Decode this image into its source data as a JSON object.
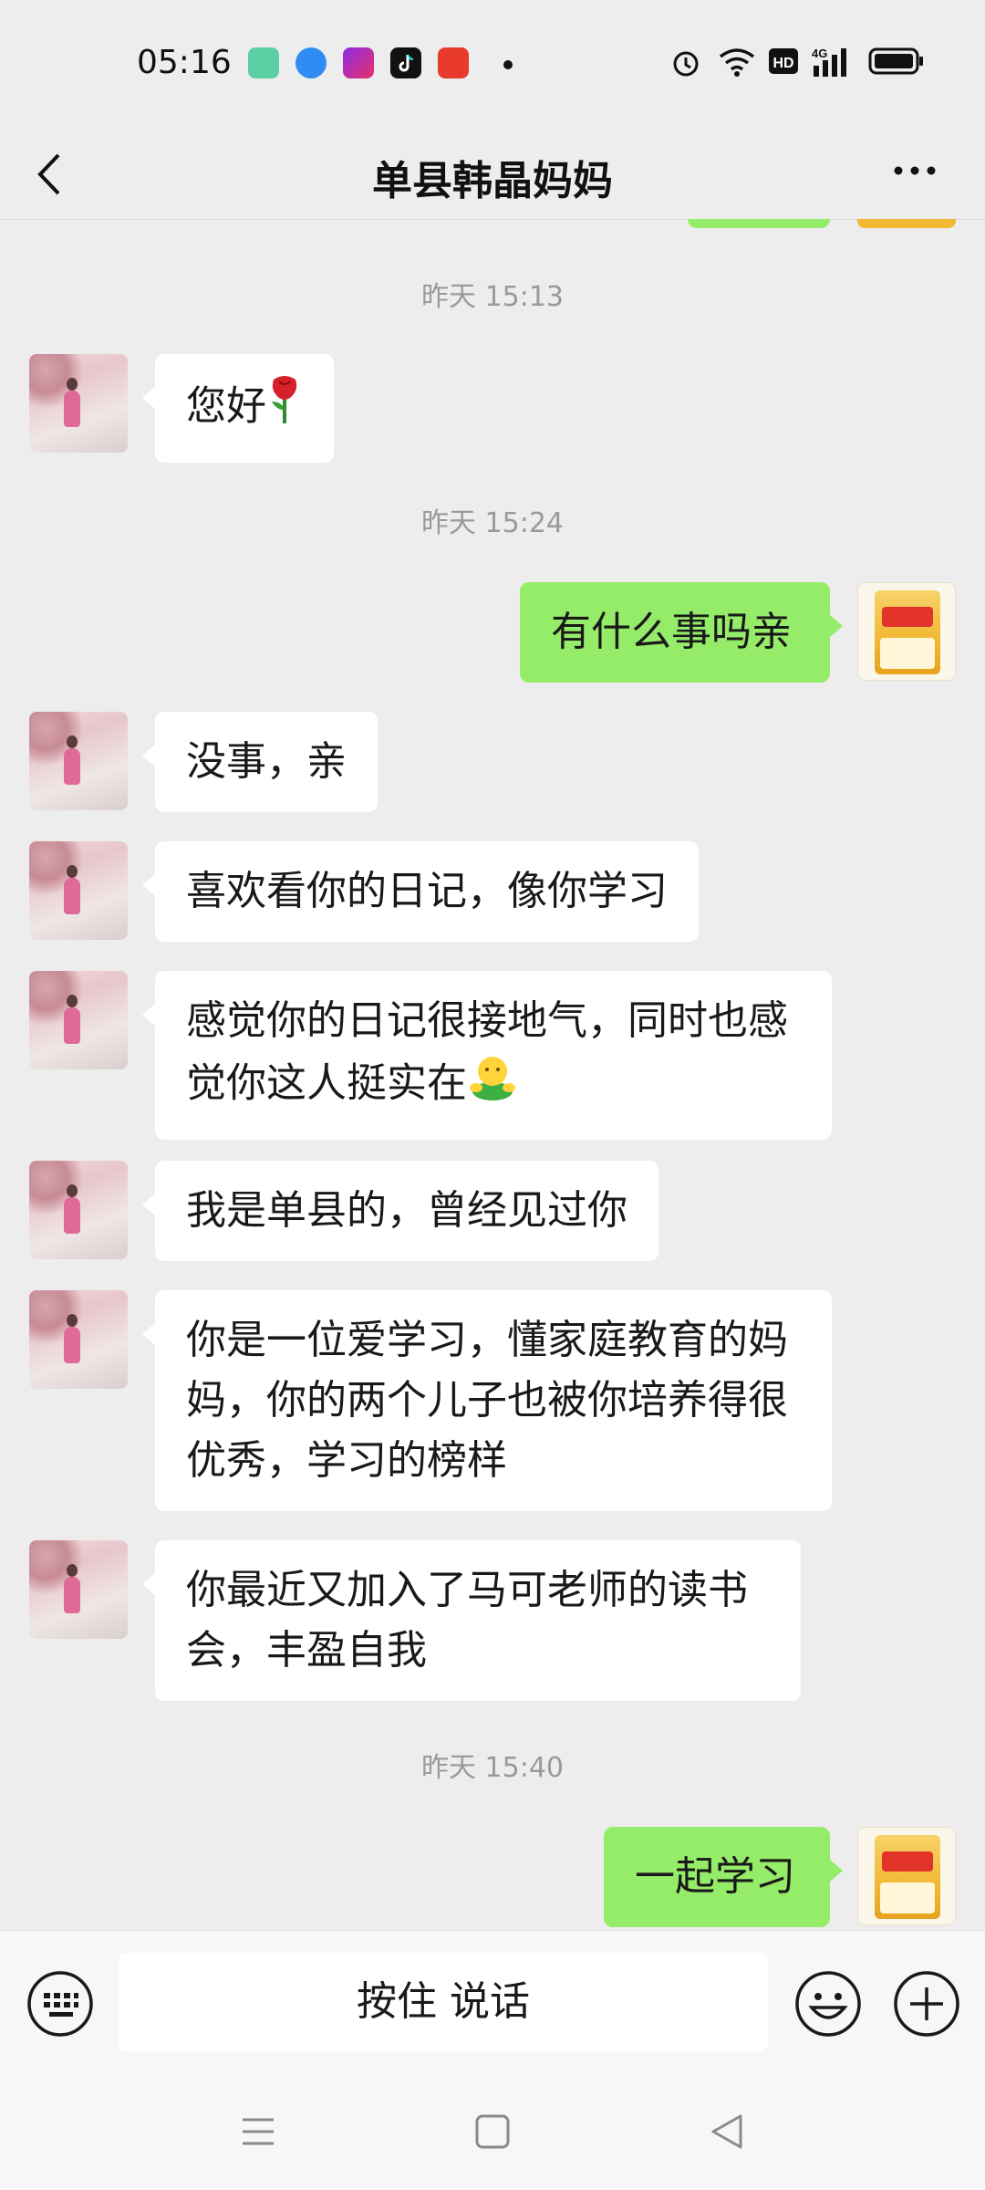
{
  "status_bar": {
    "time": "05:16",
    "app_icons": [
      "appstore-icon",
      "browser-icon",
      "video-icon",
      "douyin-icon",
      "listen-icon"
    ],
    "right_icons": [
      "alarm-icon",
      "wifi-icon",
      "hd-icon",
      "signal-4g-icon",
      "battery-icon"
    ]
  },
  "header": {
    "title": "单县韩晶妈妈",
    "back_icon": "chevron-left-icon",
    "more_icon": "more-dots-icon"
  },
  "messages": [
    {
      "type": "timestamp",
      "text": "昨天 15:13"
    },
    {
      "type": "msg",
      "side": "left",
      "text": "您好",
      "emoji": "rose"
    },
    {
      "type": "timestamp",
      "text": "昨天 15:24"
    },
    {
      "type": "msg",
      "side": "right",
      "text": "有什么事吗亲"
    },
    {
      "type": "msg",
      "side": "left",
      "text": "没事，亲"
    },
    {
      "type": "msg",
      "side": "left",
      "text": "喜欢看你的日记，像你学习"
    },
    {
      "type": "msg",
      "side": "left",
      "lines": [
        "感觉你的日记很接地气，同时也感",
        "觉你这人挺实在"
      ],
      "emoji": "hug"
    },
    {
      "type": "msg",
      "side": "left",
      "text": "我是单县的，曾经见过你"
    },
    {
      "type": "msg",
      "side": "left",
      "lines": [
        "你是一位爱学习，懂家庭教育的妈",
        "妈，你的两个儿子也被你培养得很",
        "优秀，学习的榜样"
      ]
    },
    {
      "type": "msg",
      "side": "left",
      "lines": [
        "你最近又加入了马可老师的读书",
        "会，丰盈自我"
      ]
    },
    {
      "type": "timestamp",
      "text": "昨天 15:40"
    },
    {
      "type": "msg",
      "side": "right",
      "text": "一起学习"
    }
  ],
  "input_bar": {
    "keyboard_icon": "keyboard-icon",
    "hold_to_talk": "按住 说话",
    "emoji_icon": "smiley-icon",
    "plus_icon": "plus-icon"
  },
  "system_nav": [
    "menu-icon",
    "home-icon",
    "back-triangle-icon"
  ],
  "colors": {
    "background": "#ededed",
    "bubble_self": "#95ec69",
    "bubble_other": "#ffffff",
    "timestamp": "#9a9a9a"
  }
}
